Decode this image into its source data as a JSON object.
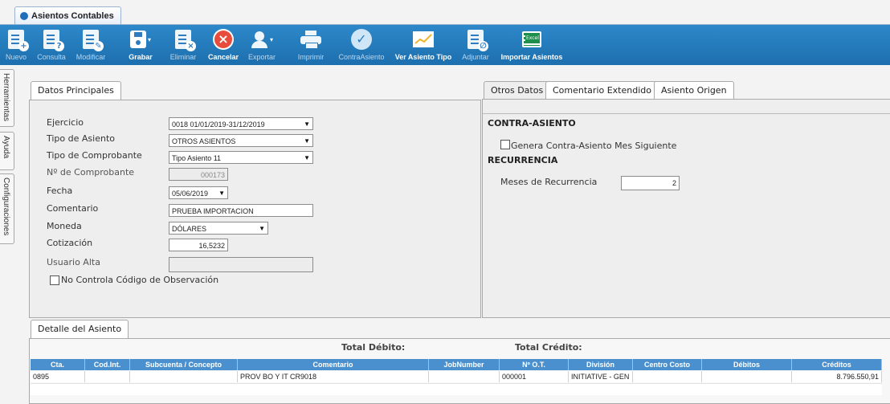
{
  "window": {
    "tab_label": "Asientos Contables"
  },
  "toolbar": {
    "buttons": [
      {
        "label": "Nuevo",
        "icon": "doc-add-icon"
      },
      {
        "label": "Consulta",
        "icon": "doc-question-icon"
      },
      {
        "label": "Modificar",
        "icon": "edit-icon"
      },
      {
        "label": "Grabar",
        "icon": "save-icon"
      },
      {
        "label": "Eliminar",
        "icon": "doc-delete-icon"
      },
      {
        "label": "Cancelar",
        "icon": "cancel-icon"
      },
      {
        "label": "Exportar",
        "icon": "export-icon"
      },
      {
        "label": "Imprimir",
        "icon": "print-icon"
      },
      {
        "label": "ContraAsiento",
        "icon": "check-icon"
      },
      {
        "label": "Ver Asiento Tipo",
        "icon": "chart-icon"
      },
      {
        "label": "Adjuntar",
        "icon": "attach-icon"
      },
      {
        "label": "Importar Asientos",
        "icon": "excel-icon"
      }
    ],
    "excel_text": "Excel"
  },
  "side_tabs": {
    "tools": "Herramientas",
    "help": "Ayuda",
    "config": "Configuraciones"
  },
  "datos_principales": {
    "tab": "Datos Principales",
    "ejercicio_label": "Ejercicio",
    "ejercicio_value": "0018 01/01/2019-31/12/2019",
    "tipo_asiento_label": "Tipo de Asiento",
    "tipo_asiento_value": "OTROS ASIENTOS",
    "tipo_comprobante_label": "Tipo de Comprobante",
    "tipo_comprobante_value": "Tipo Asiento 11",
    "nro_comprobante_label": "Nº de Comprobante",
    "nro_comprobante_value": "000173",
    "fecha_label": "Fecha",
    "fecha_value": "05/06/2019",
    "comentario_label": "Comentario",
    "comentario_value": "PRUEBA IMPORTACION",
    "moneda_label": "Moneda",
    "moneda_value": "DÓLARES",
    "cotizacion_label": "Cotización",
    "cotizacion_value": "16,5232",
    "usuario_alta_label": "Usuario Alta",
    "usuario_alta_value": "",
    "no_controla_label": "No Controla Código de Observación"
  },
  "otros_datos": {
    "tabs": [
      "Otros Datos",
      "Comentario Extendido",
      "Asiento Origen"
    ],
    "contra_asiento_title": "CONTRA-ASIENTO",
    "genera_label": "Genera Contra-Asiento Mes Siguiente",
    "recurrencia_title": "RECURRENCIA",
    "meses_label": "Meses de Recurrencia",
    "meses_value": "2"
  },
  "detalle": {
    "tab": "Detalle del Asiento",
    "total_debito_label": "Total Débito:",
    "total_credito_label": "Total Crédito:",
    "columns": [
      "Cta.",
      "Cod.Int.",
      "Subcuenta / Concepto",
      "Comentario",
      "JobNumber",
      "Nº O.T.",
      "División",
      "Centro Costo",
      "Débitos",
      "Créditos"
    ],
    "rows": [
      [
        "0895",
        "",
        "",
        "PROV BO Y IT CR9018",
        "",
        "000001",
        "INITIATIVE - GEN",
        "",
        "",
        "8.796.550,91"
      ]
    ]
  }
}
